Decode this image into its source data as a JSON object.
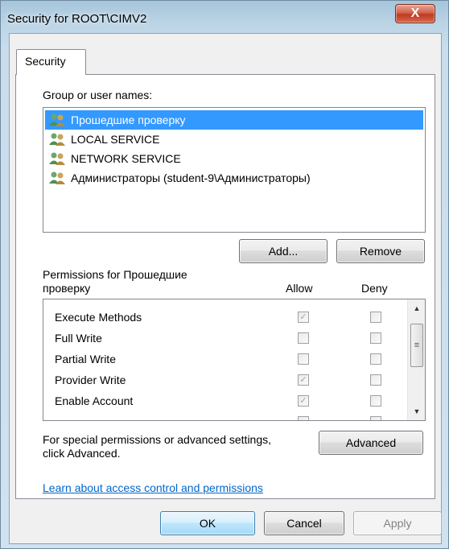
{
  "window": {
    "title": "Security for ROOT\\CIMV2",
    "close_label": "X"
  },
  "tabs": [
    {
      "label": "Security"
    }
  ],
  "groups": {
    "label": "Group or user names:",
    "items": [
      {
        "name": "Прошедшие проверку",
        "selected": true
      },
      {
        "name": "LOCAL SERVICE",
        "selected": false
      },
      {
        "name": "NETWORK SERVICE",
        "selected": false
      },
      {
        "name": "Администраторы (student-9\\Администраторы)",
        "selected": false
      }
    ],
    "add_label": "Add...",
    "remove_label": "Remove"
  },
  "permissions": {
    "label_line1": "Permissions for Прошедшие",
    "label_line2": "проверку",
    "allow_header": "Allow",
    "deny_header": "Deny",
    "rows": [
      {
        "name": "Execute Methods",
        "allow": true,
        "deny": false
      },
      {
        "name": "Full Write",
        "allow": false,
        "deny": false
      },
      {
        "name": "Partial Write",
        "allow": false,
        "deny": false
      },
      {
        "name": "Provider Write",
        "allow": true,
        "deny": false
      },
      {
        "name": "Enable Account",
        "allow": true,
        "deny": false
      }
    ]
  },
  "advanced": {
    "text_line1": "For special permissions or advanced settings,",
    "text_line2": "click Advanced.",
    "button_label": "Advanced"
  },
  "link_text": "Learn about access control and permissions",
  "footer": {
    "ok_label": "OK",
    "cancel_label": "Cancel",
    "apply_label": "Apply"
  },
  "colors": {
    "selection": "#3399ff",
    "link": "#0066cc",
    "close": "#c0391f"
  },
  "icons": {
    "user_group": "users-icon",
    "check": "checkmark"
  }
}
